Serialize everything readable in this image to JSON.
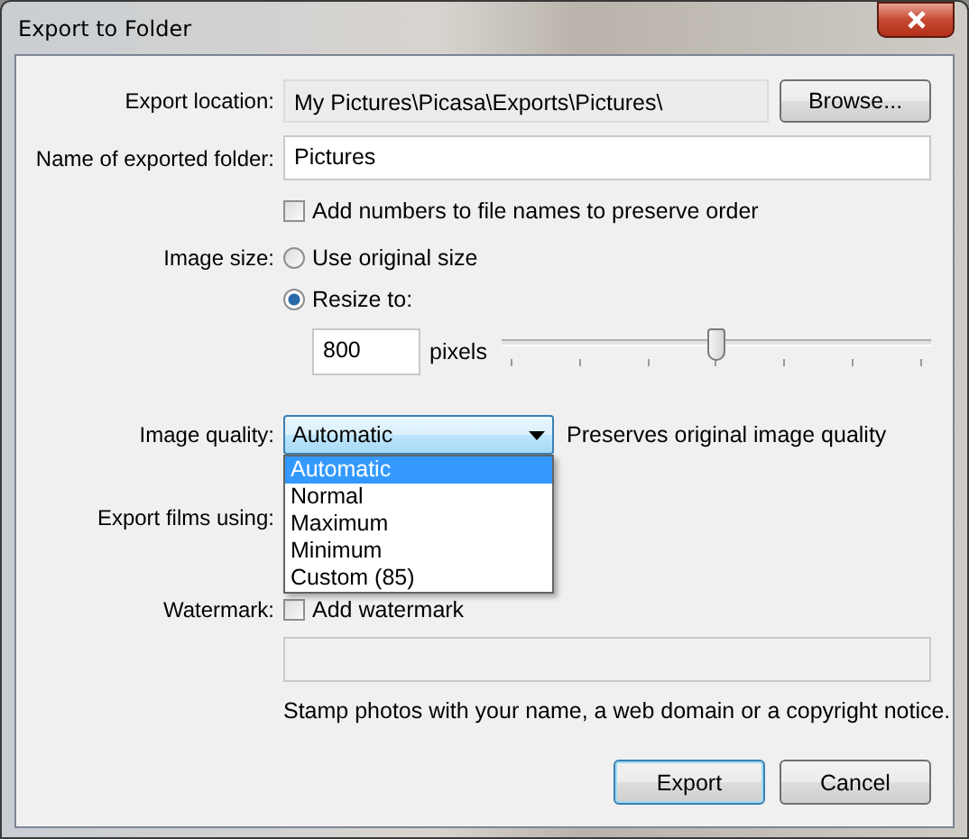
{
  "window": {
    "title": "Export to Folder"
  },
  "export_location": {
    "label": "Export location:",
    "value": "My Pictures\\Picasa\\Exports\\Pictures\\",
    "button": "Browse..."
  },
  "folder_name": {
    "label": "Name of exported folder:",
    "value": "Pictures"
  },
  "add_numbers": {
    "label": "Add numbers to file names to preserve order",
    "checked": false
  },
  "image_size": {
    "label": "Image size:",
    "options": [
      {
        "label": "Use original size",
        "selected": false
      },
      {
        "label": "Resize to:",
        "selected": true
      }
    ]
  },
  "resize": {
    "value": "800",
    "unit": "pixels",
    "level": 0.5
  },
  "image_quality": {
    "label": "Image quality:",
    "value": "Automatic",
    "note": "Preserves original image quality",
    "expanded": true,
    "options": [
      {
        "label": "Automatic",
        "selected": true
      },
      {
        "label": "Normal",
        "selected": false
      },
      {
        "label": "Maximum",
        "selected": false
      },
      {
        "label": "Minimum",
        "selected": false
      },
      {
        "label": "Custom (85)",
        "selected": false
      }
    ]
  },
  "export_films": {
    "label": "Export films using:"
  },
  "watermark": {
    "label": "Watermark:",
    "checkbox_label": "Add watermark",
    "checked": false,
    "hint": "Stamp photos with your name, a web domain or a copyright notice."
  },
  "buttons": [
    {
      "label": "Export",
      "default": true
    },
    {
      "label": "Cancel",
      "default": false
    }
  ]
}
